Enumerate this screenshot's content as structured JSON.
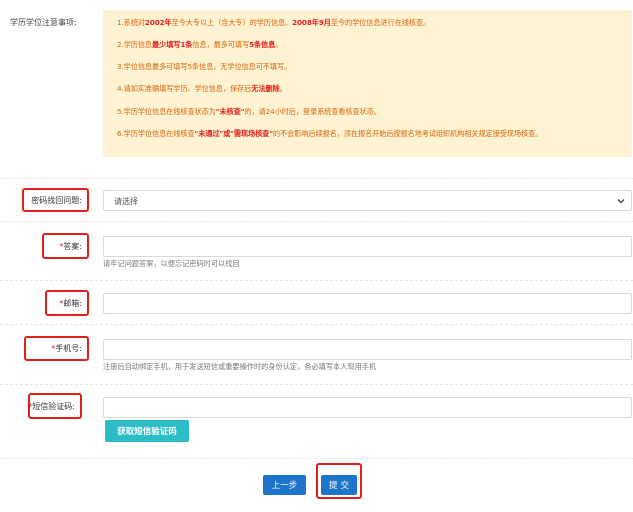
{
  "notice": {
    "label": "学历学位注意事项:",
    "lines": [
      {
        "parts": [
          {
            "t": "1.系统对"
          },
          {
            "t": "2002年",
            "hl": true
          },
          {
            "t": "至今大专以上（含大专）的学历信息、"
          },
          {
            "t": "2008年9月",
            "hl": true
          },
          {
            "t": "至今的学位信息进行在线核查。"
          }
        ]
      },
      {
        "parts": [
          {
            "t": "2.学历信息"
          },
          {
            "t": "最少填写1条",
            "hl": true
          },
          {
            "t": "信息，最多可填写"
          },
          {
            "t": "5条信息",
            "hl": true
          },
          {
            "t": "。"
          }
        ]
      },
      {
        "parts": [
          {
            "t": "3.学位信息最多可填写5条信息，无学位信息可不填写。"
          }
        ]
      },
      {
        "parts": [
          {
            "t": "4.请如实准确填写学历、学位信息，保存后"
          },
          {
            "t": "无法删除",
            "hl": true
          },
          {
            "t": "。"
          }
        ]
      },
      {
        "parts": [
          {
            "t": "5.学历学位信息在线核查状态为"
          },
          {
            "t": "\"未核查\"",
            "hl": true
          },
          {
            "t": "的，请24小时后，登录系统查看核查状态。"
          }
        ]
      },
      {
        "parts": [
          {
            "t": "6.学历学位信息在线核查"
          },
          {
            "t": "\"未通过\"或\"需现场核查\"",
            "hl": true
          },
          {
            "t": "的不会影响后续报名，须在报名开始后按报名地考试组织机构相关规定接受现场核查。"
          }
        ]
      }
    ]
  },
  "form": {
    "question_label": "密码找回问题:",
    "question_select_value": "请选择",
    "answer_label": "答案:",
    "answer_hint": "请牢记问题答案，以便忘记密码时可以找回",
    "email_label": "邮箱:",
    "phone_label": "手机号:",
    "phone_hint": "注册后自动绑定手机，用于发送短信或重要操作时的身份认定，务必填写本人现用手机",
    "sms_label": "短信验证码:",
    "required_mark": "*",
    "sms_button": "获取短信验证码",
    "prev_button": "上一步",
    "submit_button": "提交"
  },
  "colors": {
    "accent_red": "#e0201c",
    "notice_bg": "#fdf3d2",
    "notice_text": "#d9640a",
    "primary_blue": "#1e74c9",
    "teal": "#2bbdc6"
  }
}
